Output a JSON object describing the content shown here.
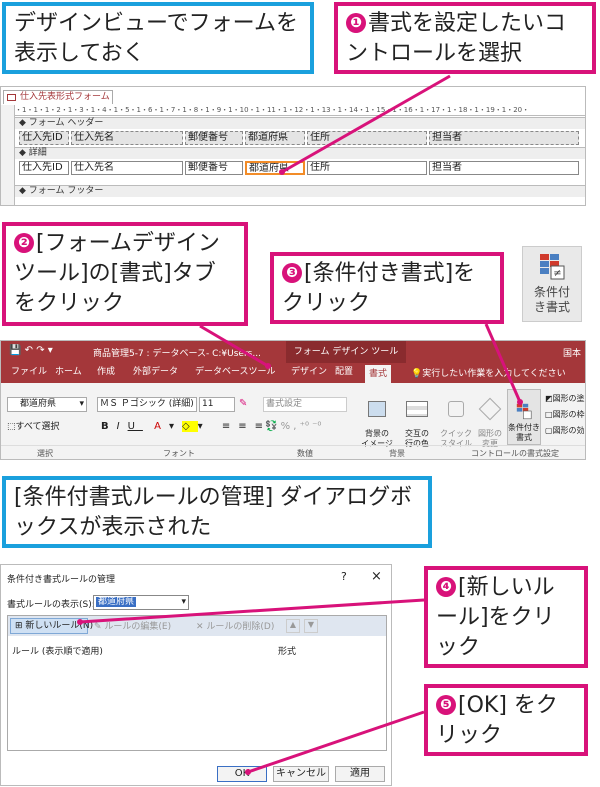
{
  "callouts": {
    "top_left": "デザインビューでフォームを表示しておく",
    "step1_num": "❶",
    "step1": "書式を設定したいコントロールを選択",
    "step2_num": "❷",
    "step2": "[フォームデザインツール]の[書式]タブをクリック",
    "step3_num": "❸",
    "step3": "[条件付き書式]をクリック",
    "dialog_shown": "[条件付書式ルールの管理] ダイアログボックスが表示された",
    "step4_num": "❹",
    "step4": "[新しいルール]をクリック",
    "step5_num": "❺",
    "step5": "[OK] をクリック"
  },
  "form_design": {
    "tab_title": "仕入先表形式フォーム",
    "ruler": "・1・1・1・2・1・3・1・4・1・5・1・6・1・7・1・8・1・9・1・10・1・11・1・12・1・13・1・14・1・15・1・16・1・17・1・18・1・19・1・20・",
    "header_section": "フォーム ヘッダー",
    "detail_section": "詳細",
    "footer_section": "フォーム フッター",
    "header_labels": [
      "仕入先ID",
      "仕入先名",
      "郵便番号",
      "都道府県",
      "住所",
      "担当者"
    ],
    "detail_fields": [
      "仕入先ID",
      "仕入先名",
      "郵便番号",
      "都道府県",
      "住所",
      "担当者"
    ]
  },
  "cond_icon": {
    "label": "条件付き書式"
  },
  "ribbon": {
    "title": "商品管理5-7 : データベース- C:¥Users...",
    "tool_title": "フォーム デザイン ツール",
    "app_right": "国本",
    "tabs": [
      "ファイル",
      "ホーム",
      "作成",
      "外部データ",
      "データベースツール",
      "デザイン",
      "配置",
      "書式"
    ],
    "active_tab": "書式",
    "tell_me": "実行したい作業を入力してください",
    "object_select": "都道府県",
    "select_all": "すべて選択",
    "font_name": "ＭＳ Ｐゴシック (詳細)",
    "font_size": "11",
    "format_select": "書式設定",
    "bg_image": "背景の\nイメージ",
    "alt_row": "交互の\n行の色",
    "quick_style": "クイック\nスタイル",
    "change_shape": "図形の\n変更",
    "cond_format": "条件付き\n書式",
    "shape_fill": "図形の塗",
    "shape_outline": "図形の枠",
    "shape_effect": "図形の効",
    "groups": [
      "選択",
      "フォント",
      "数値",
      "背景",
      "コントロールの書式設定"
    ]
  },
  "dialog": {
    "title": "条件付き書式ルールの管理",
    "help": "?",
    "close": "×",
    "show_rules_label": "書式ルールの表示(S):",
    "show_rules_value": "都道府県",
    "new_rule": "新しいルール(N)",
    "edit_rule": "ルールの編集(E)",
    "delete_rule": "ルールの削除(D)",
    "col_rule": "ルール (表示順で適用)",
    "col_format": "形式",
    "ok": "OK",
    "cancel": "キャンセル",
    "apply": "適用"
  },
  "colors": {
    "pink": "#d8127a",
    "blue": "#1aa0dd",
    "access_red": "#a4373a"
  }
}
